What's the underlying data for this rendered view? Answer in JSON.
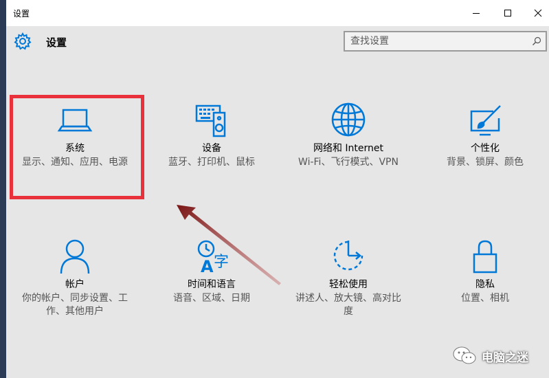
{
  "window": {
    "title": "设置",
    "controls": {
      "minimize": "minimize",
      "maximize": "maximize",
      "close": "close"
    }
  },
  "header": {
    "title": "设置",
    "search_placeholder": "查找设置"
  },
  "tiles": [
    {
      "name": "系统",
      "desc": "显示、通知、应用、电源",
      "icon": "laptop-icon"
    },
    {
      "name": "设备",
      "desc": "蓝牙、打印机、鼠标",
      "icon": "keyboard-speaker-icon"
    },
    {
      "name": "网络和 Internet",
      "desc": "Wi-Fi、飞行模式、VPN",
      "icon": "globe-icon"
    },
    {
      "name": "个性化",
      "desc": "背景、锁屏、颜色",
      "icon": "paint-brush-icon"
    },
    {
      "name": "帐户",
      "desc": "你的帐户、同步设置、工作、其他用户",
      "icon": "person-icon"
    },
    {
      "name": "时间和语言",
      "desc": "语音、区域、日期",
      "icon": "clock-language-icon"
    },
    {
      "name": "轻松使用",
      "desc": "讲述人、放大镜、高对比度",
      "icon": "ease-of-access-icon"
    },
    {
      "name": "隐私",
      "desc": "位置、相机",
      "icon": "lock-icon"
    }
  ],
  "watermark": {
    "text": "电脑之迷"
  },
  "colors": {
    "accent": "#0078d7",
    "highlight": "#e8313a",
    "arrow": "#7a1515"
  }
}
